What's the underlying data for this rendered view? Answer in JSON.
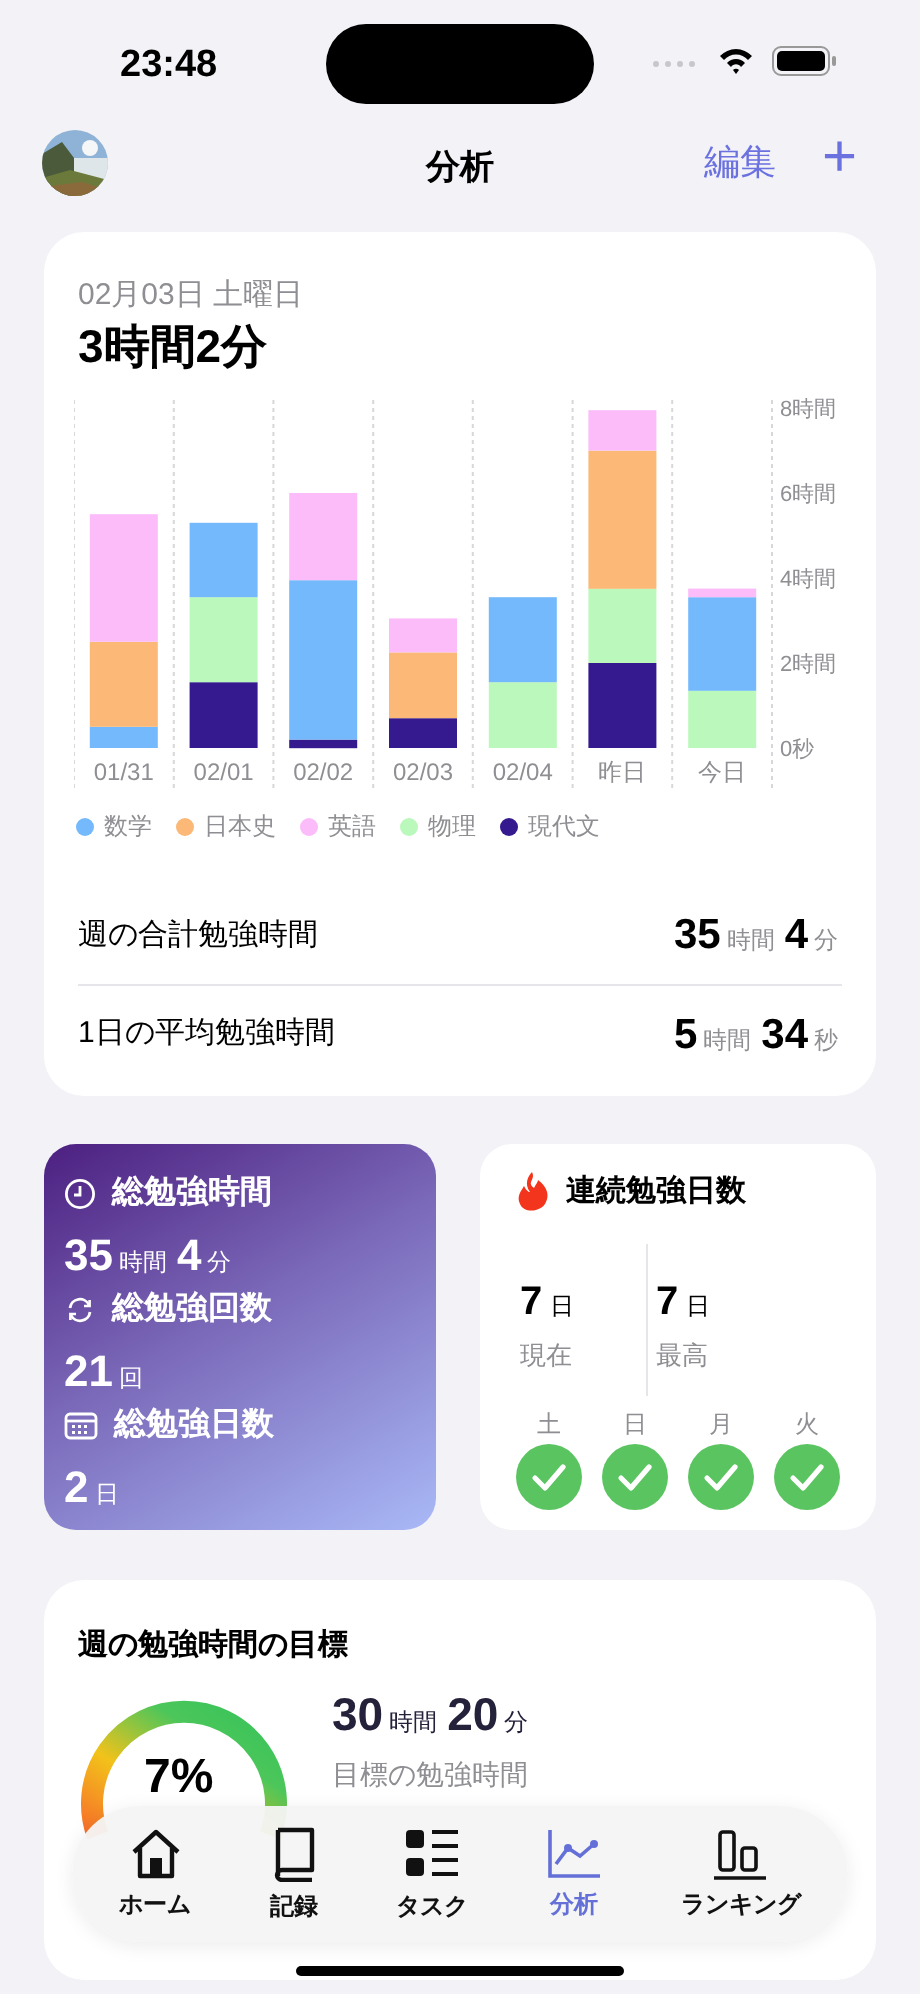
{
  "status_bar": {
    "time": "23:48"
  },
  "header": {
    "title": "分析",
    "edit": "編集",
    "add": "+"
  },
  "daily": {
    "date": "02月03日 土曜日",
    "total": "3時間2分",
    "chart_data": {
      "type": "bar",
      "stacked": true,
      "categories": [
        "01/31",
        "02/01",
        "02/02",
        "02/03",
        "02/04",
        "昨日",
        "今日"
      ],
      "ylim": [
        0,
        8
      ],
      "yticks": [
        {
          "value": 0,
          "label": "0秒"
        },
        {
          "value": 2,
          "label": "2時間"
        },
        {
          "value": 4,
          "label": "4時間"
        },
        {
          "value": 6,
          "label": "6時間"
        },
        {
          "value": 8,
          "label": "8時間"
        }
      ],
      "series": [
        {
          "name": "数学",
          "color": "#74b9fb",
          "values": [
            0.5,
            1.75,
            3.75,
            0,
            2.0,
            0,
            2.2
          ]
        },
        {
          "name": "日本史",
          "color": "#fbb877",
          "values": [
            2.0,
            0,
            0,
            1.55,
            0,
            3.25,
            0
          ]
        },
        {
          "name": "英語",
          "color": "#fbbcf9",
          "values": [
            3.0,
            0,
            2.05,
            0.8,
            0,
            0.95,
            0.2
          ]
        },
        {
          "name": "物理",
          "color": "#bbf8bc",
          "values": [
            0,
            2.0,
            0,
            0,
            1.55,
            1.75,
            1.35
          ]
        },
        {
          "name": "現代文",
          "color": "#341a8e",
          "values": [
            0,
            1.55,
            0.2,
            0.7,
            0,
            2.0,
            0
          ]
        }
      ]
    },
    "stats": [
      {
        "label": "週の合計勉強時間",
        "value": [
          {
            "num": "35",
            "unit": "時間"
          },
          {
            "num": "4",
            "unit": "分"
          }
        ]
      },
      {
        "label": "1日の平均勉強時間",
        "value": [
          {
            "num": "5",
            "unit": "時間"
          },
          {
            "num": "34",
            "unit": "秒"
          }
        ]
      }
    ]
  },
  "totals": [
    {
      "kind": "time",
      "label": "総勉強時間",
      "value": [
        {
          "num": "35",
          "unit": "時間"
        },
        {
          "num": "4",
          "unit": "分"
        }
      ]
    },
    {
      "kind": "count",
      "label": "総勉強回数",
      "value": [
        {
          "num": "21",
          "unit": "回"
        }
      ]
    },
    {
      "kind": "days",
      "label": "総勉強日数",
      "value": [
        {
          "num": "2",
          "unit": "日"
        }
      ]
    }
  ],
  "streak": {
    "title": "連続勉強日数",
    "current": {
      "num": "7",
      "unit": "日",
      "label": "現在"
    },
    "best": {
      "num": "7",
      "unit": "日",
      "label": "最高"
    },
    "days": [
      {
        "label": "土",
        "checked": true
      },
      {
        "label": "日",
        "checked": true
      },
      {
        "label": "月",
        "checked": true
      },
      {
        "label": "火",
        "checked": true
      }
    ]
  },
  "goal": {
    "title": "週の勉強時間の目標",
    "percent": "7%",
    "value": [
      {
        "num": "30",
        "unit": "時間"
      },
      {
        "num": "20",
        "unit": "分"
      }
    ],
    "caption": "目標の勉強時間"
  },
  "tab_bar": [
    {
      "kind": "home",
      "label": "ホーム",
      "selected": false
    },
    {
      "kind": "book",
      "label": "記録",
      "selected": false
    },
    {
      "kind": "list",
      "label": "タスク",
      "selected": false
    },
    {
      "kind": "chart",
      "label": "分析",
      "selected": true
    },
    {
      "kind": "ranking",
      "label": "ランキング",
      "selected": false
    }
  ]
}
